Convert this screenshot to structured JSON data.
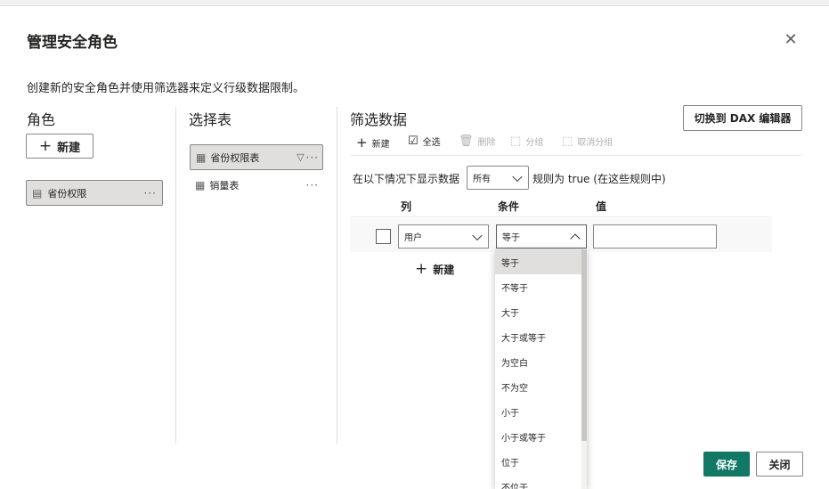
{
  "dialog": {
    "title": "管理安全角色",
    "close_symbol": "✕",
    "description": "创建新的安全角色并使用筛选器来定义行级数据限制。"
  },
  "roles": {
    "header": "角色",
    "new_label": "新建",
    "items": [
      {
        "label": "省份权限"
      }
    ]
  },
  "tables": {
    "header": "选择表",
    "items": [
      {
        "label": "省份权限表"
      },
      {
        "label": "销量表"
      }
    ]
  },
  "filter": {
    "header": "筛选数据",
    "dax_button": "切换到 DAX 编辑器",
    "toolbar": {
      "new": "新建",
      "select_all": "全选",
      "delete": "删除",
      "group": "分组",
      "ungroup": "取消分组"
    },
    "show_prefix": "在以下情况下显示数据",
    "show_mode": "所有",
    "show_suffix": "规则为 true (在这些规则中)",
    "columns": {
      "col": "列",
      "condition": "条件",
      "value": "值"
    },
    "rule": {
      "column": "用户",
      "condition": "等于",
      "value": ""
    },
    "add_rule_label": "新建",
    "condition_options": [
      "等于",
      "不等于",
      "大于",
      "大于或等于",
      "为空白",
      "不为空",
      "小于",
      "小于或等于",
      "位于",
      "不位于"
    ]
  },
  "footer": {
    "save": "保存",
    "close": "关闭"
  },
  "colors": {
    "primary": "#117865",
    "selected_bg": "#e1dfdd",
    "border": "#8a8886"
  }
}
